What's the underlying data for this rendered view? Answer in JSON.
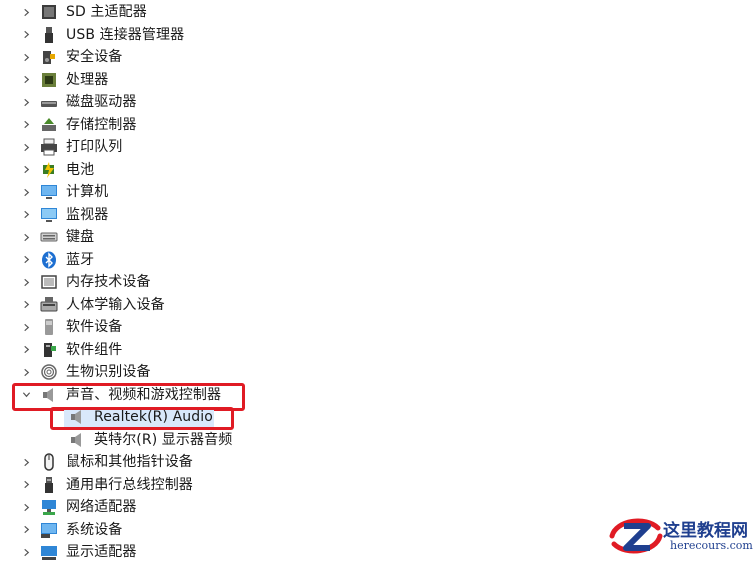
{
  "tree": {
    "items": [
      {
        "label": "SD 主适配器",
        "icon": "sd-card-icon",
        "state": "collapsed"
      },
      {
        "label": "USB 连接器管理器",
        "icon": "usb-icon",
        "state": "collapsed"
      },
      {
        "label": "安全设备",
        "icon": "security-key-icon",
        "state": "collapsed"
      },
      {
        "label": "处理器",
        "icon": "processor-icon",
        "state": "collapsed"
      },
      {
        "label": "磁盘驱动器",
        "icon": "disk-drive-icon",
        "state": "collapsed"
      },
      {
        "label": "存储控制器",
        "icon": "storage-controller-icon",
        "state": "collapsed"
      },
      {
        "label": "打印队列",
        "icon": "printer-icon",
        "state": "collapsed"
      },
      {
        "label": "电池",
        "icon": "battery-icon",
        "state": "collapsed"
      },
      {
        "label": "计算机",
        "icon": "computer-icon",
        "state": "collapsed"
      },
      {
        "label": "监视器",
        "icon": "monitor-icon",
        "state": "collapsed"
      },
      {
        "label": "键盘",
        "icon": "keyboard-icon",
        "state": "collapsed"
      },
      {
        "label": "蓝牙",
        "icon": "bluetooth-icon",
        "state": "collapsed"
      },
      {
        "label": "内存技术设备",
        "icon": "memory-icon",
        "state": "collapsed"
      },
      {
        "label": "人体学输入设备",
        "icon": "hid-icon",
        "state": "collapsed"
      },
      {
        "label": "软件设备",
        "icon": "software-device-icon",
        "state": "collapsed"
      },
      {
        "label": "软件组件",
        "icon": "software-component-icon",
        "state": "collapsed"
      },
      {
        "label": "生物识别设备",
        "icon": "fingerprint-icon",
        "state": "collapsed"
      },
      {
        "label": "声音、视频和游戏控制器",
        "icon": "speaker-icon",
        "state": "expanded"
      },
      {
        "label": "鼠标和其他指针设备",
        "icon": "mouse-icon",
        "state": "collapsed"
      },
      {
        "label": "通用串行总线控制器",
        "icon": "usb-controller-icon",
        "state": "collapsed"
      },
      {
        "label": "网络适配器",
        "icon": "network-adapter-icon",
        "state": "collapsed"
      },
      {
        "label": "系统设备",
        "icon": "system-device-icon",
        "state": "collapsed"
      },
      {
        "label": "显示适配器",
        "icon": "display-adapter-icon",
        "state": "collapsed"
      }
    ],
    "audio_children": [
      {
        "label": "Realtek(R) Audio",
        "icon": "speaker-icon",
        "highlighted": true
      },
      {
        "label": "英特尔(R) 显示器音频",
        "icon": "speaker-icon",
        "highlighted": false
      }
    ]
  },
  "watermark": {
    "title": "这里教程网",
    "subtitle": "herecours.com"
  },
  "colors": {
    "highlight": "#e01b24",
    "selection": "#d9e8fb",
    "brand": "#1f3f8f"
  }
}
